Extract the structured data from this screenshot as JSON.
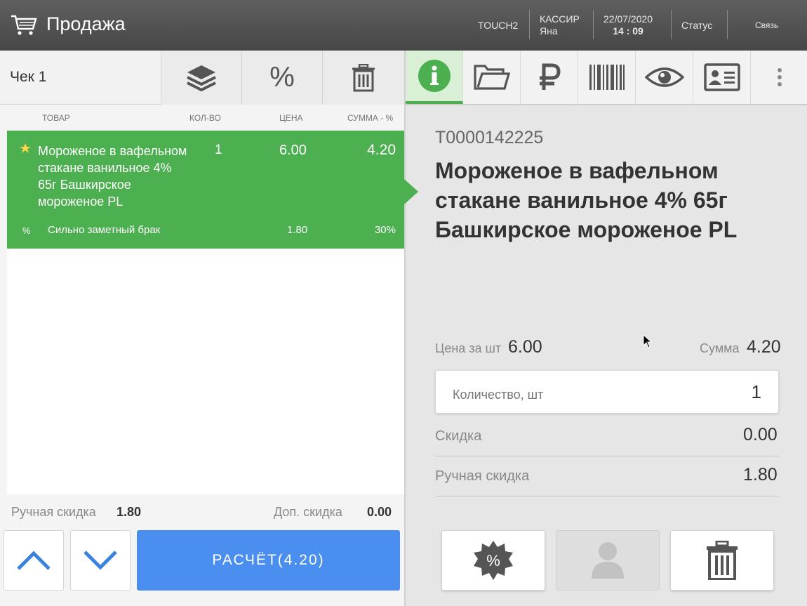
{
  "app": {
    "title": "Продажа"
  },
  "header": {
    "terminal": "TOUCH2",
    "cashier_label": "КАССИР",
    "cashier_name": "Яна",
    "date": "22/07/2020",
    "time": "14 : 09",
    "status": "Статус",
    "connection": "Связь"
  },
  "receipt": {
    "title": "Чек 1",
    "columns": {
      "item": "ТОВАР",
      "qty": "КОЛ-ВО",
      "price": "ЦЕНА",
      "sum": "СУММА - %"
    },
    "items": [
      {
        "name": "Мороженое в вафельном стакане ванильное 4% 65г Башкирское мороженое PL",
        "qty": "1",
        "price": "6.00",
        "sum": "4.20",
        "discount": {
          "symbol": "%",
          "name": "Сильно заметный брак",
          "value": "1.80",
          "percent": "30%"
        }
      }
    ],
    "manual_discount_label": "Ручная скидка",
    "manual_discount_value": "1.80",
    "extra_discount_label": "Доп. скидка",
    "extra_discount_value": "0.00",
    "pay_button": "РАСЧЁТ(4.20)"
  },
  "product": {
    "code": "T0000142225",
    "name": "Мороженое в вафельном стакане ванильное 4% 65г Башкирское мороженое PL",
    "price_label": "Цена за шт",
    "price_value": "6.00",
    "sum_label": "Сумма",
    "sum_value": "4.20",
    "qty_placeholder": "Количество, шт",
    "qty_value": "1",
    "discount_label": "Скидка",
    "discount_value": "0.00",
    "manual_discount_label": "Ручная скидка",
    "manual_discount_value": "1.80"
  },
  "colors": {
    "accent_green": "#4caf50",
    "pay_blue": "#4a8ef0",
    "arrow_blue": "#3b82e0"
  },
  "icons": [
    "cart-icon",
    "layers-icon",
    "percent-icon",
    "trash-icon",
    "info-icon",
    "folder-icon",
    "ruble-icon",
    "barcode-icon",
    "eye-icon",
    "id-card-icon",
    "more-vertical-icon",
    "chevron-up-icon",
    "chevron-down-icon",
    "discount-badge-icon",
    "user-icon"
  ]
}
